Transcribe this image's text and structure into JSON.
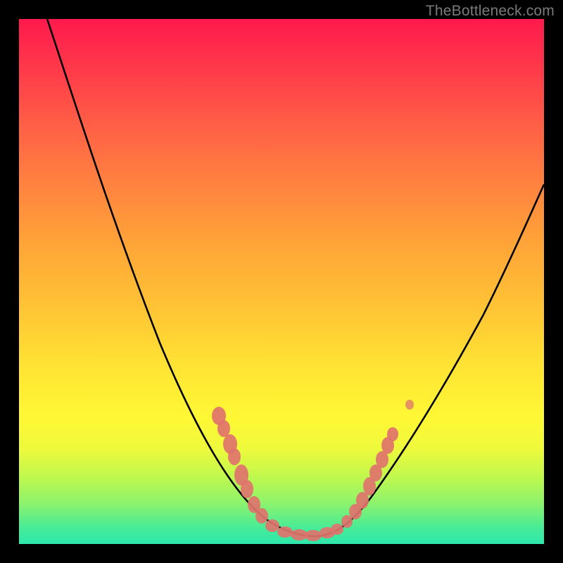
{
  "watermark": "TheBottleneck.com",
  "chart_data": {
    "type": "line",
    "title": "",
    "xlabel": "",
    "ylabel": "",
    "xlim": [
      0,
      100
    ],
    "ylim": [
      0,
      100
    ],
    "grid": false,
    "legend": false,
    "series": [
      {
        "name": "bottleneck-curve",
        "color": "#000000",
        "x": [
          5,
          10,
          15,
          20,
          25,
          30,
          35,
          40,
          45,
          48,
          50,
          52,
          55,
          58,
          60,
          65,
          70,
          75,
          80,
          85,
          90,
          95,
          100
        ],
        "y": [
          100,
          85,
          70,
          56,
          43,
          33,
          24,
          16,
          9,
          5,
          3,
          2,
          2,
          3,
          6,
          10,
          17,
          25,
          33,
          42,
          50,
          57,
          63
        ]
      }
    ],
    "markers": [
      {
        "name": "left-cluster",
        "color": "#e0726c",
        "x_range": [
          38,
          47
        ],
        "y_range": [
          4,
          22
        ]
      },
      {
        "name": "bottom-cluster",
        "color": "#e0726c",
        "x_range": [
          48,
          58
        ],
        "y_range": [
          1,
          4
        ]
      },
      {
        "name": "right-cluster",
        "color": "#e0726c",
        "x_range": [
          60,
          68
        ],
        "y_range": [
          5,
          18
        ]
      }
    ],
    "background_bands": [
      {
        "color": "#ff1a4d",
        "y": 100
      },
      {
        "color": "#ffa238",
        "y": 58
      },
      {
        "color": "#fff835",
        "y": 24
      },
      {
        "color": "#47eb98",
        "y": 3
      },
      {
        "color": "#2de8ac",
        "y": 0
      }
    ]
  }
}
